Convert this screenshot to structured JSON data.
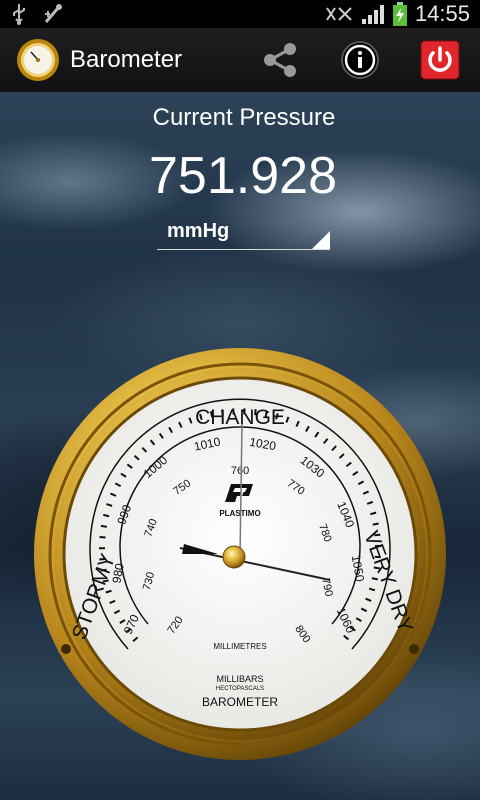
{
  "status_bar": {
    "time": "14:55"
  },
  "app": {
    "title": "Barometer"
  },
  "actions": {
    "share_icon": "share-icon",
    "info_icon": "info-icon",
    "power_icon": "power-icon",
    "power_color": "#e0262b"
  },
  "pressure": {
    "label": "Current Pressure",
    "value": "751.928",
    "unit": "mmHg"
  },
  "gauge": {
    "brand": "PLASTIMO",
    "word_left": "STORMY",
    "word_top": "CHANGE",
    "word_right": "VERY DRY",
    "scale_outer_label": "MILLIBARS",
    "scale_outer_sublabel": "HECTOPASCALS",
    "scale_inner_label": "MILLIMETRES",
    "bottom_label": "BAROMETER",
    "millibar_ticks": [
      "970",
      "980",
      "990",
      "1000",
      "1010",
      "1020",
      "1030",
      "1040",
      "1050",
      "1060"
    ],
    "mm_ticks": [
      "720",
      "730",
      "740",
      "750",
      "760",
      "770",
      "780",
      "790",
      "800"
    ],
    "bezel_color": "#c9a227"
  }
}
